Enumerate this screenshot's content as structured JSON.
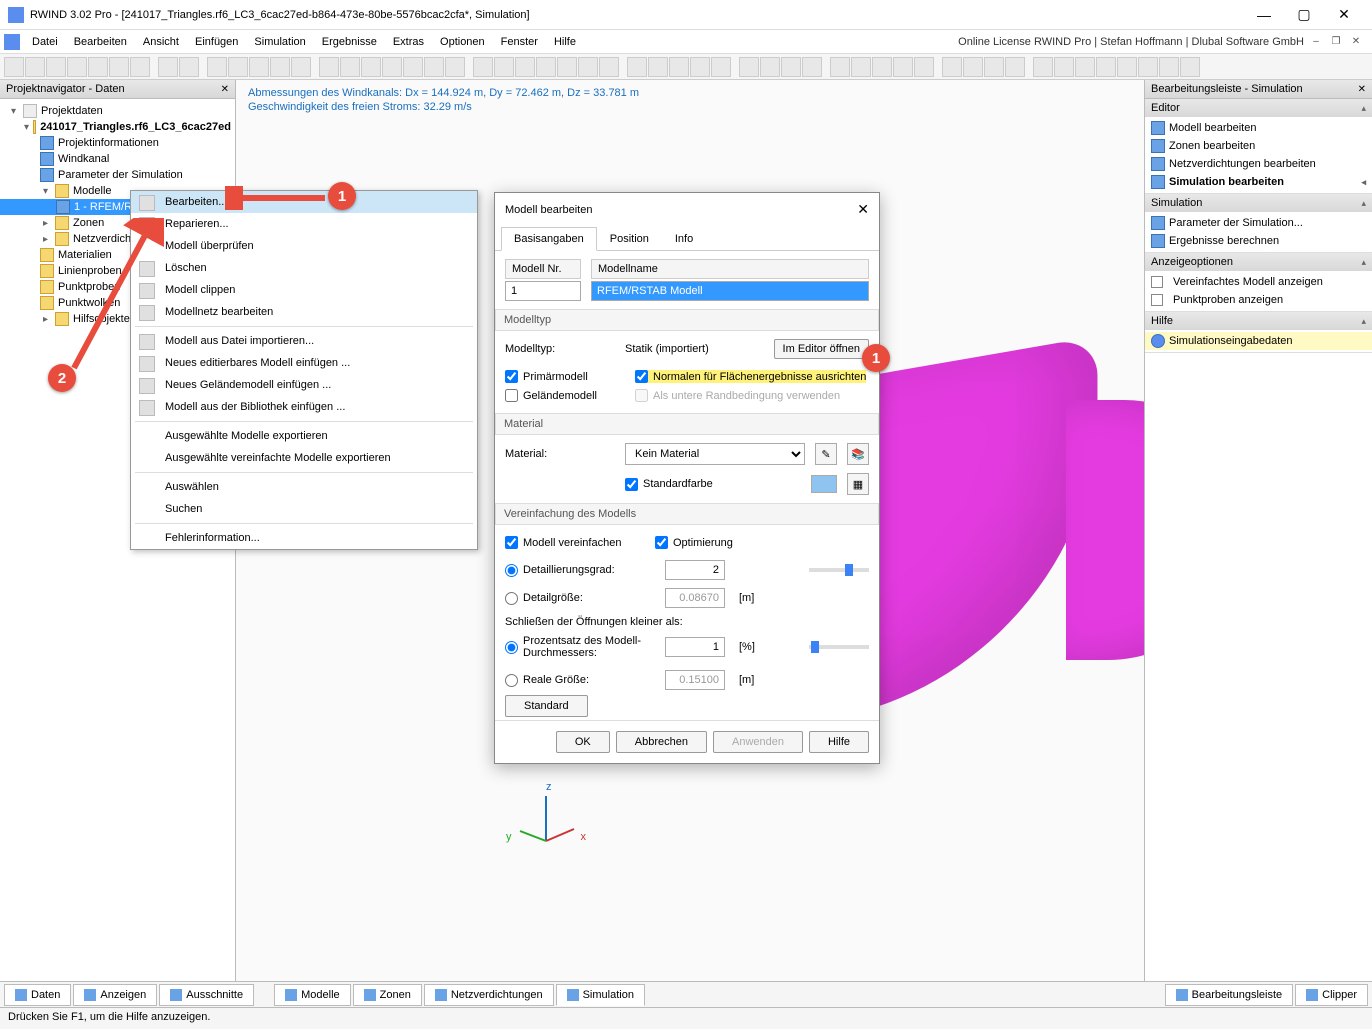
{
  "title": "RWIND 3.02 Pro - [241017_Triangles.rf6_LC3_6cac27ed-b864-473e-80be-5576bcac2cfa*, Simulation]",
  "license_text": "Online License RWIND Pro | Stefan Hoffmann | Dlubal Software GmbH",
  "menu": {
    "items": [
      "Datei",
      "Bearbeiten",
      "Ansicht",
      "Einfügen",
      "Simulation",
      "Ergebnisse",
      "Extras",
      "Optionen",
      "Fenster",
      "Hilfe"
    ]
  },
  "nav_panel_title": "Projektnavigator - Daten",
  "tree": {
    "root": "Projektdaten",
    "project": "241017_Triangles.rf6_LC3_6cac27ed",
    "items": [
      "Projektinformationen",
      "Windkanal",
      "Parameter der Simulation"
    ],
    "modelle": "Modelle",
    "model_sel": "1 - RFEM/RSTAB M...",
    "rest": [
      "Zonen",
      "Netzverdichtungen",
      "Materialien",
      "Linienproben",
      "Punktproben",
      "Punktwolken",
      "Hilfsobjekte"
    ]
  },
  "viewport": {
    "line1": "Abmessungen des Windkanals: Dx = 144.924 m, Dy = 72.462 m, Dz = 33.781 m",
    "line2": "Geschwindigkeit des freien Stroms: 32.29 m/s"
  },
  "ctx": {
    "items": [
      "Bearbeiten...",
      "Reparieren...",
      "Modell überprüfen",
      "Löschen",
      "Modell clippen",
      "Modellnetz bearbeiten",
      "Modell aus Datei importieren...",
      "Neues editierbares Modell einfügen ...",
      "Neues Geländemodell einfügen ...",
      "Modell aus der Bibliothek einfügen ...",
      "Ausgewählte Modelle exportieren",
      "Ausgewählte vereinfachte Modelle exportieren",
      "Auswählen",
      "Suchen",
      "Fehlerinformation..."
    ]
  },
  "dlg": {
    "title": "Modell bearbeiten",
    "tabs": [
      "Basisangaben",
      "Position",
      "Info"
    ],
    "modell_nr_label": "Modell Nr.",
    "modell_nr": "1",
    "modellname_label": "Modellname",
    "modellname": "RFEM/RSTAB Modell",
    "modelltyp_head": "Modelltyp",
    "modelltyp_label": "Modelltyp:",
    "statik": "Statik (importiert)",
    "im_editor": "Im Editor öffnen",
    "primarmodell": "Primärmodell",
    "gelandemodell": "Geländemodell",
    "normalen": "Normalen für Flächenergebnisse ausrichten",
    "randbed": "Als untere Randbedingung verwenden",
    "material_head": "Material",
    "material_label": "Material:",
    "material_val": "Kein Material",
    "standardfarbe": "Standardfarbe",
    "vereinf_head": "Vereinfachung des Modells",
    "modell_vereinf": "Modell vereinfachen",
    "optimierung": "Optimierung",
    "detail_grad": "Detaillierungsgrad:",
    "detail_grad_val": "2",
    "detail_groesse": "Detailgröße:",
    "detail_groesse_val": "0.08670",
    "unit_m": "[m]",
    "schliessen": "Schließen der Öffnungen kleiner als:",
    "prozentsatz": "Prozentsatz des Modell-Durchmessers:",
    "prozent_val": "1",
    "unit_pct": "[%]",
    "reale": "Reale Größe:",
    "reale_val": "0.15100",
    "standard_btn": "Standard",
    "ok": "OK",
    "cancel": "Abbrechen",
    "apply": "Anwenden",
    "help": "Hilfe"
  },
  "right": {
    "title": "Bearbeitungsleiste - Simulation",
    "editor": "Editor",
    "editor_items": [
      "Modell bearbeiten",
      "Zonen bearbeiten",
      "Netzverdichtungen bearbeiten",
      "Simulation bearbeiten"
    ],
    "simulation": "Simulation",
    "sim_items": [
      "Parameter der Simulation...",
      "Ergebnisse berechnen"
    ],
    "anzeige": "Anzeigeoptionen",
    "anz_items": [
      "Vereinfachtes Modell anzeigen",
      "Punktproben anzeigen"
    ],
    "hilfe": "Hilfe",
    "hilfe_item": "Simulationseingabedaten"
  },
  "bottom": {
    "left": [
      "Daten",
      "Anzeigen",
      "Ausschnitte"
    ],
    "center": [
      "Modelle",
      "Zonen",
      "Netzverdichtungen",
      "Simulation"
    ],
    "right": [
      "Bearbeitungsleiste",
      "Clipper"
    ]
  },
  "status": "Drücken Sie F1, um die Hilfe anzuzeigen."
}
